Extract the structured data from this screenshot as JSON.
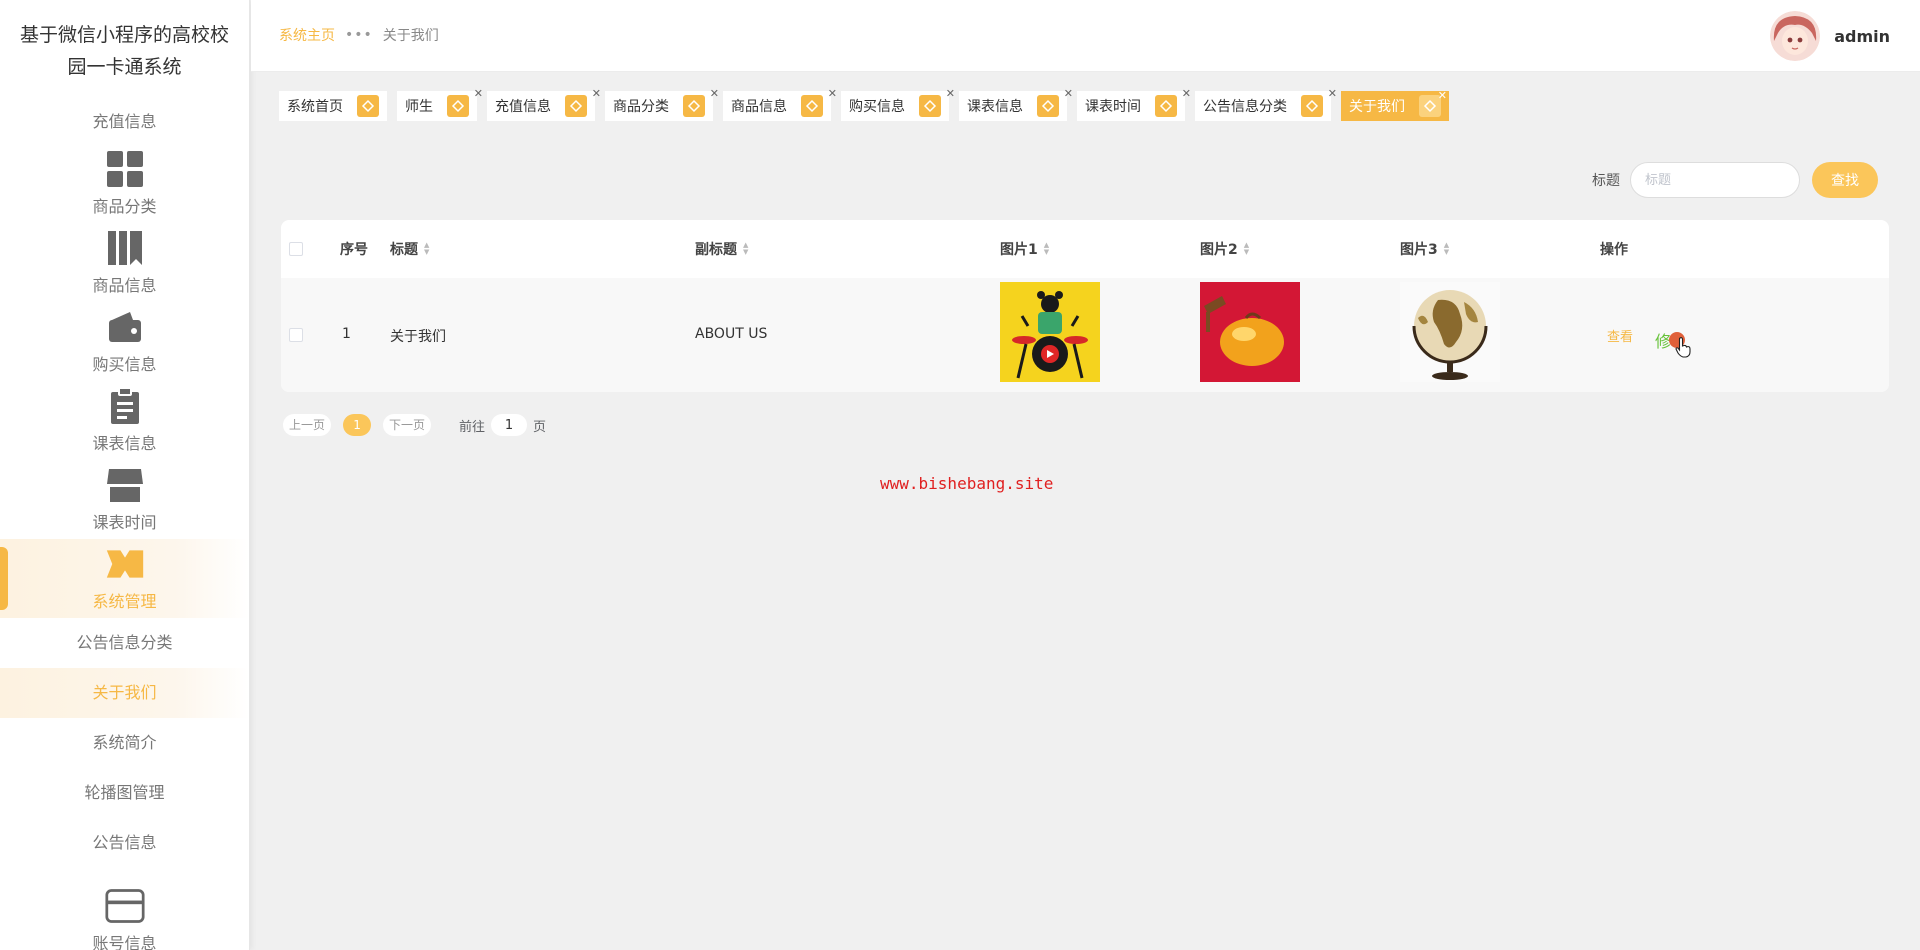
{
  "sidebar": {
    "title_line1": "基于微信小程序的高校校",
    "title_line2": "园一卡通系统",
    "top_item": "充值信息",
    "icon_items": [
      {
        "label": "商品分类",
        "icon": "grid-icon"
      },
      {
        "label": "商品信息",
        "icon": "book-icon"
      },
      {
        "label": "购买信息",
        "icon": "wallet-icon"
      },
      {
        "label": "课表信息",
        "icon": "clipboard-icon"
      },
      {
        "label": "课表时间",
        "icon": "shop-icon"
      },
      {
        "label": "系统管理",
        "icon": "ticket-icon",
        "active": true
      }
    ],
    "sub_items": [
      "公告信息分类",
      "关于我们",
      "系统简介",
      "轮播图管理",
      "公告信息"
    ],
    "bottom_item": {
      "label": "账号信息",
      "icon": "card-icon"
    }
  },
  "header": {
    "crumb_home": "系统主页",
    "crumb_current": "关于我们",
    "username": "admin"
  },
  "tags": [
    {
      "label": "系统首页",
      "closable": false
    },
    {
      "label": "师生",
      "closable": true
    },
    {
      "label": "充值信息",
      "closable": true
    },
    {
      "label": "商品分类",
      "closable": true
    },
    {
      "label": "商品信息",
      "closable": true
    },
    {
      "label": "购买信息",
      "closable": true
    },
    {
      "label": "课表信息",
      "closable": true
    },
    {
      "label": "课表时间",
      "closable": true
    },
    {
      "label": "公告信息分类",
      "closable": true
    },
    {
      "label": "关于我们",
      "closable": true,
      "active": true
    }
  ],
  "search": {
    "label": "标题",
    "placeholder": "标题",
    "button": "查找"
  },
  "table": {
    "columns": [
      "序号",
      "标题",
      "副标题",
      "图片1",
      "图片2",
      "图片3",
      "操作"
    ],
    "rows": [
      {
        "index": "1",
        "title": "关于我们",
        "subtitle": "ABOUT US",
        "view": "查看",
        "edit": "修"
      }
    ]
  },
  "pager": {
    "prev": "上一页",
    "page": "1",
    "next": "下一页",
    "goto": "前往",
    "goto_value": "1",
    "page_unit": "页"
  },
  "watermark": "www.bishebang.site",
  "colors": {
    "accent": "#f6b845",
    "edit": "#67c23a",
    "watermark": "#e02020"
  }
}
